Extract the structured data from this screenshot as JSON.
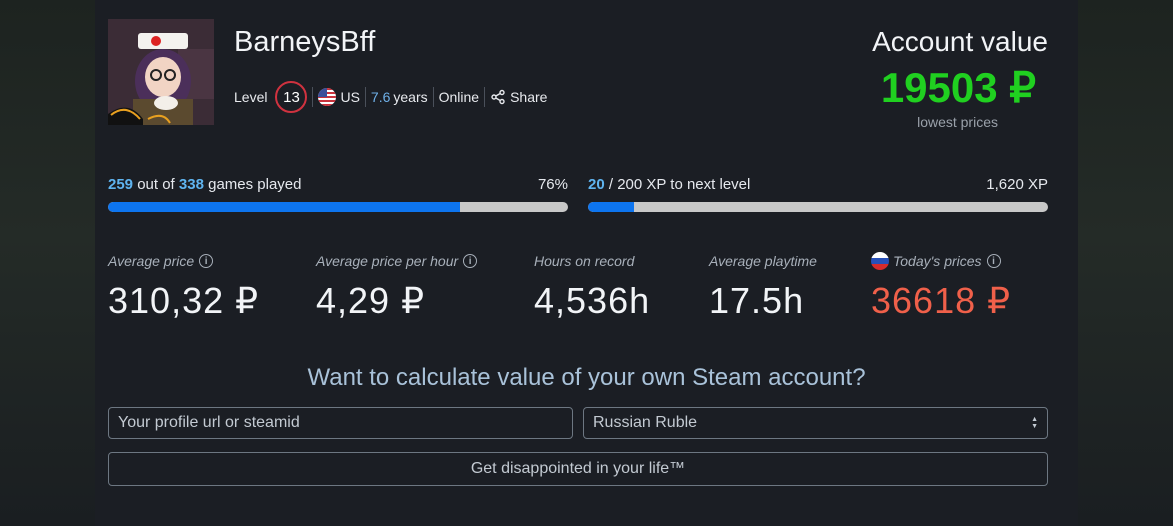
{
  "profile": {
    "username": "BarneysBff",
    "level_label": "Level",
    "level": "13",
    "country": "US",
    "years_number": "7.6",
    "years_label": "years",
    "status": "Online",
    "share_label": "Share"
  },
  "account": {
    "title": "Account value",
    "value": "19503 ₽",
    "note": "lowest prices",
    "value_color": "#20d020"
  },
  "progress": {
    "games": {
      "played": "259",
      "mid_text": " out of ",
      "total": "338",
      "end_text": " games played",
      "percent_label": "76%",
      "fraction": 0.766
    },
    "xp": {
      "current": "20",
      "rest_text": " / 200 XP to next level",
      "total_label": "1,620 XP",
      "fraction": 0.1
    },
    "bar_color": "#0d75f0"
  },
  "stats": [
    {
      "label": "Average price",
      "value": "310,32 ₽"
    },
    {
      "label": "Average price per hour",
      "value": "4,29 ₽"
    },
    {
      "label": "Hours on record",
      "value": "4,536h"
    },
    {
      "label": "Average playtime",
      "value": "17.5h"
    },
    {
      "label": "Today's prices",
      "value": "36618 ₽",
      "value_color": "#f0604a"
    }
  ],
  "calculator": {
    "heading": "Want to calculate value of your own Steam account?",
    "input_placeholder": "Your profile url or steamid",
    "currency_selected": "Russian Ruble",
    "button_label": "Get disappointed in your life™"
  }
}
